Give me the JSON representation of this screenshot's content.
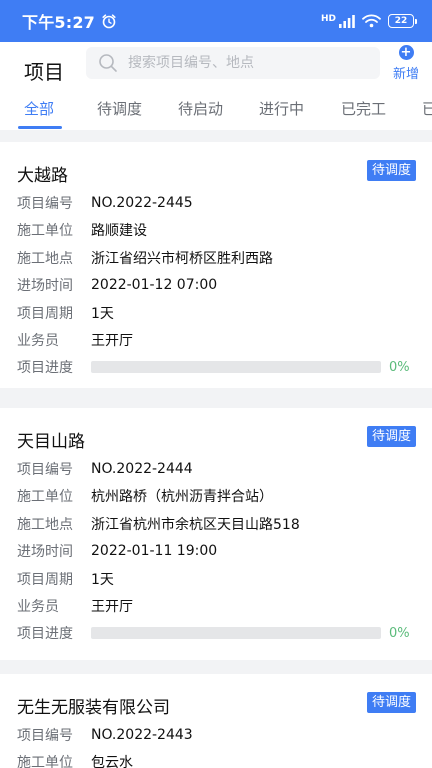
{
  "status_bar": {
    "time": "下午5:27",
    "network": "HD",
    "battery": "22"
  },
  "header": {
    "title": "项目",
    "search_placeholder": "搜索项目编号、地点",
    "add_label": "新增"
  },
  "tabs": [
    {
      "label": "全部",
      "active": true
    },
    {
      "label": "待调度",
      "active": false
    },
    {
      "label": "待启动",
      "active": false
    },
    {
      "label": "进行中",
      "active": false
    },
    {
      "label": "已完工",
      "active": false
    },
    {
      "label": "已",
      "active": false
    }
  ],
  "field_labels": {
    "project_no": "项目编号",
    "contractor": "施工单位",
    "location": "施工地点",
    "entry_time": "进场时间",
    "period": "项目周期",
    "salesperson": "业务员",
    "progress": "项目进度"
  },
  "projects": [
    {
      "name": "大越路",
      "status": "待调度",
      "project_no": "NO.2022-2445",
      "contractor": "路顺建设",
      "location": "浙江省绍兴市柯桥区胜利西路",
      "entry_time": "2022-01-12 07:00",
      "period": "1天",
      "salesperson": "王开厅",
      "progress": 0,
      "progress_label": "0%"
    },
    {
      "name": "天目山路",
      "status": "待调度",
      "project_no": "NO.2022-2444",
      "contractor": "杭州路桥（杭州沥青拌合站）",
      "location": "浙江省杭州市余杭区天目山路518",
      "entry_time": "2022-01-11 19:00",
      "period": "1天",
      "salesperson": "王开厅",
      "progress": 0,
      "progress_label": "0%"
    },
    {
      "name": "无生无服装有限公司",
      "status": "待调度",
      "project_no": "NO.2022-2443",
      "contractor": "包云水"
    }
  ],
  "colors": {
    "accent": "#3f7df4",
    "progress": "#5bbb7b",
    "background": "#f2f3f5"
  }
}
